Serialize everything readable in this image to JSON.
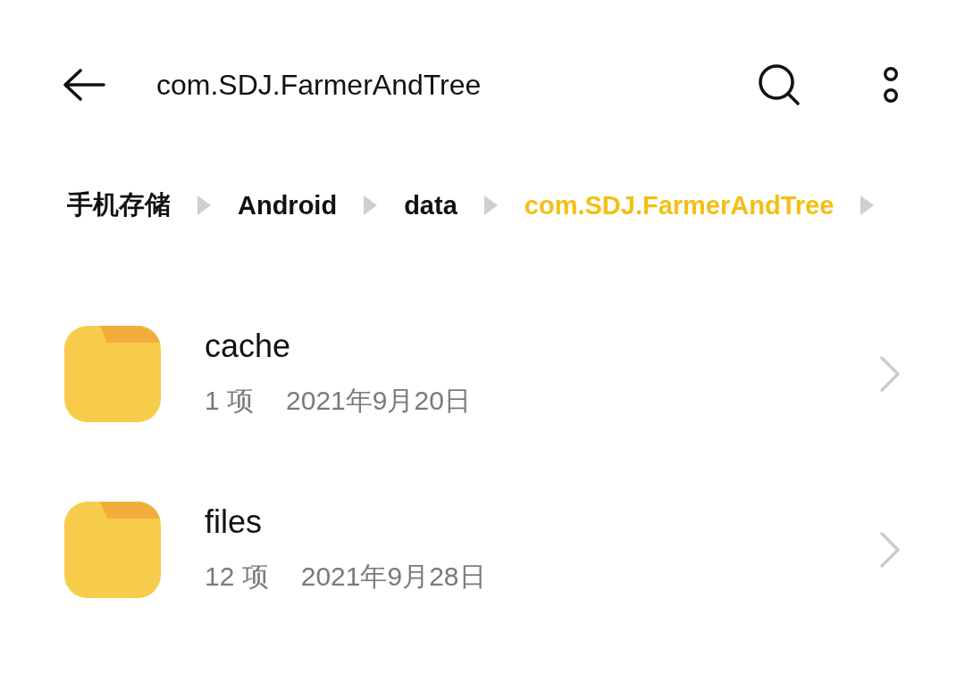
{
  "toolbar": {
    "title": "com.SDJ.FarmerAndTree"
  },
  "breadcrumb": [
    {
      "label": "手机存储",
      "selected": false
    },
    {
      "label": "Android",
      "selected": false
    },
    {
      "label": "data",
      "selected": false
    },
    {
      "label": "com.SDJ.FarmerAndTree",
      "selected": true
    }
  ],
  "folders": [
    {
      "name": "cache",
      "item_count": "1 项",
      "modified": "2021年9月20日"
    },
    {
      "name": "files",
      "item_count": "12 项",
      "modified": "2021年9月28日"
    }
  ]
}
